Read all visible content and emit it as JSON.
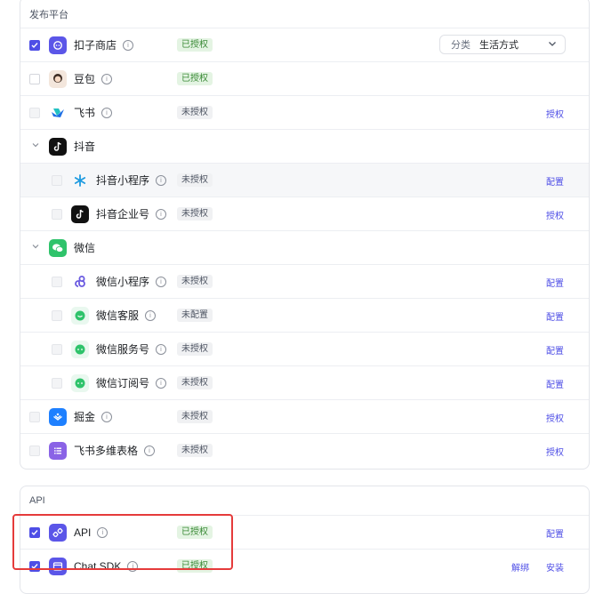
{
  "publish": {
    "title": "发布平台",
    "select": {
      "label": "分类",
      "value": "生活方式"
    },
    "rows": [
      {
        "name": "扣子商店",
        "status": "已授权",
        "action": ""
      },
      {
        "name": "豆包",
        "status": "已授权",
        "action": ""
      },
      {
        "name": "飞书",
        "status": "未授权",
        "action": "授权"
      },
      {
        "name": "抖音"
      },
      {
        "name": "抖音小程序",
        "status": "未授权",
        "action": "配置"
      },
      {
        "name": "抖音企业号",
        "status": "未授权",
        "action": "授权"
      },
      {
        "name": "微信"
      },
      {
        "name": "微信小程序",
        "status": "未授权",
        "action": "配置"
      },
      {
        "name": "微信客服",
        "status": "未配置",
        "action": "配置"
      },
      {
        "name": "微信服务号",
        "status": "未授权",
        "action": "配置"
      },
      {
        "name": "微信订阅号",
        "status": "未授权",
        "action": "配置"
      },
      {
        "name": "掘金",
        "status": "未授权",
        "action": "授权"
      },
      {
        "name": "飞书多维表格",
        "status": "未授权",
        "action": "授权"
      }
    ]
  },
  "api": {
    "title": "API",
    "rows": [
      {
        "name": "API",
        "status": "已授权",
        "action": "配置"
      },
      {
        "name": "Chat SDK",
        "status": "已授权",
        "action": "安装",
        "action2": "解绑"
      }
    ]
  },
  "info_glyph": "i",
  "colors": {
    "accent": "#4e4ee6",
    "highlight": "#e53b3b"
  }
}
